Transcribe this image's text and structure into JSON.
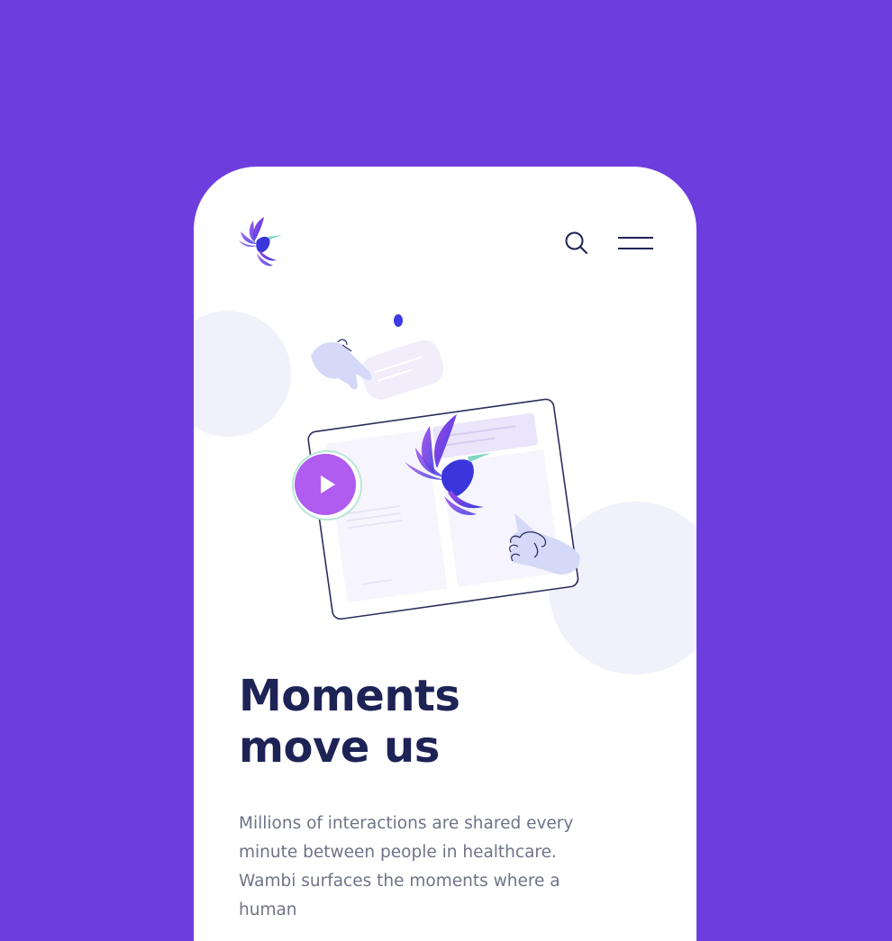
{
  "brand": {
    "logo_icon": "hummingbird-logo-icon",
    "accent": "#6E3DDE",
    "logo_gradient": [
      "#9B4DE8",
      "#3A3BE0"
    ]
  },
  "header": {
    "search_icon": "search-icon",
    "menu_icon": "hamburger-menu-icon"
  },
  "hero": {
    "illustration": "tablet-with-hummingbird-illustration",
    "play_icon": "play-icon",
    "colors": {
      "play_button": "#B05CF0",
      "card_fill": "#F4F1FC",
      "hand_fill": "#D4D9F7",
      "circle_fill": "#F1F1FB"
    }
  },
  "content": {
    "headline_line1": "Moments",
    "headline_line2": "move us",
    "body": "Millions of interactions are shared every minute between people in healthcare. Wambi surfaces the moments where a human"
  },
  "colors": {
    "background": "#6E3DDE",
    "card": "#FFFFFF",
    "headline": "#1E2356",
    "body_text": "#6E7386"
  }
}
